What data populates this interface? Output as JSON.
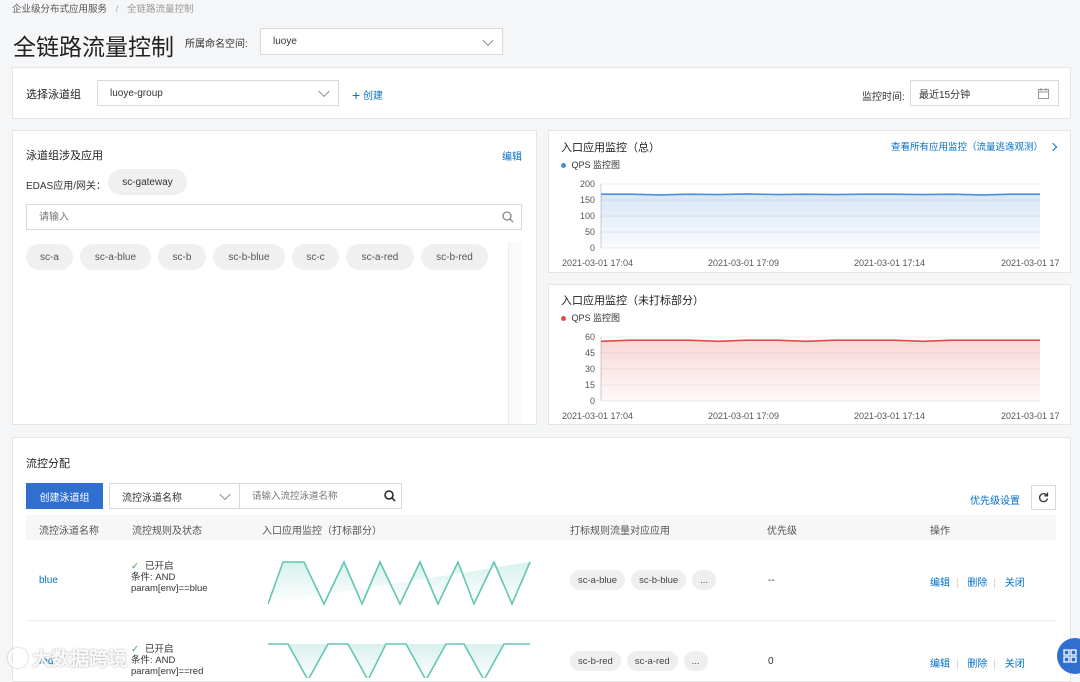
{
  "breadcrumb": {
    "parent": "企业级分布式应用服务",
    "separator": "/",
    "current": "全链路流量控制"
  },
  "page_title": "全链路流量控制",
  "namespace": {
    "label": "所属命名空间:",
    "value": "luoye"
  },
  "lane_group": {
    "label": "选择泳道组",
    "value": "luoye-group",
    "create": "创建",
    "monitor_label": "监控时间:",
    "monitor_value": "最近15分钟"
  },
  "apps_panel": {
    "title": "泳道组涉及应用",
    "edit": "编辑",
    "gateway_label": "EDAS应用/网关：",
    "gateway_tag": "sc-gateway",
    "search_placeholder": "请输入",
    "apps": [
      "sc-a",
      "sc-a-blue",
      "sc-b",
      "sc-b-blue",
      "sc-c",
      "sc-a-red",
      "sc-b-red"
    ]
  },
  "chart_top": {
    "title": "入口应用监控（总）",
    "link": "查看所有应用监控（流量逃逸观测）",
    "legend": "QPS 监控图"
  },
  "chart_bottom": {
    "title": "入口应用监控（未打标部分）",
    "legend": "QPS 监控图"
  },
  "chart_data": [
    {
      "type": "area",
      "series": [
        {
          "name": "QPS 监控图",
          "color": "#4a90d9"
        }
      ],
      "x": [
        "2021-03-01 17:04",
        "2021-03-01 17:05",
        "2021-03-01 17:06",
        "2021-03-01 17:07",
        "2021-03-01 17:08",
        "2021-03-01 17:09",
        "2021-03-01 17:10",
        "2021-03-01 17:11",
        "2021-03-01 17:12",
        "2021-03-01 17:13",
        "2021-03-01 17:14",
        "2021-03-01 17:15",
        "2021-03-01 17:16",
        "2021-03-01 17:17",
        "2021-03-01 17:18",
        "2021-03-01 17:19"
      ],
      "values": [
        168,
        168,
        166,
        168,
        167,
        169,
        167,
        168,
        167,
        168,
        168,
        167,
        168,
        166,
        168,
        168
      ],
      "xticks": [
        "2021-03-01 17:04",
        "2021-03-01 17:09",
        "2021-03-01 17:14",
        "2021-03-01 17"
      ],
      "yticks": [
        "200",
        "150",
        "100",
        "50",
        "0"
      ],
      "ylim": [
        0,
        200
      ]
    },
    {
      "type": "area",
      "series": [
        {
          "name": "QPS 监控图",
          "color": "#e24b4b"
        }
      ],
      "x": [
        "2021-03-01 17:04",
        "2021-03-01 17:05",
        "2021-03-01 17:06",
        "2021-03-01 17:07",
        "2021-03-01 17:08",
        "2021-03-01 17:09",
        "2021-03-01 17:10",
        "2021-03-01 17:11",
        "2021-03-01 17:12",
        "2021-03-01 17:13",
        "2021-03-01 17:14",
        "2021-03-01 17:15",
        "2021-03-01 17:16",
        "2021-03-01 17:17",
        "2021-03-01 17:18",
        "2021-03-01 17:19"
      ],
      "values": [
        56,
        57,
        57,
        57,
        56,
        57,
        57,
        56,
        57,
        57,
        57,
        56,
        57,
        57,
        57,
        57
      ],
      "xticks": [
        "2021-03-01 17:04",
        "2021-03-01 17:09",
        "2021-03-01 17:14",
        "2021-03-01 17"
      ],
      "yticks": [
        "60",
        "45",
        "30",
        "15",
        "0"
      ],
      "ylim": [
        0,
        60
      ]
    }
  ],
  "flow": {
    "title": "流控分配",
    "create_button": "创建泳道组",
    "filter_select": "流控泳道名称",
    "filter_placeholder": "请输入流控泳道名称",
    "priority_settings": "优先级设置",
    "columns": [
      "流控泳道名称",
      "流控规则及状态",
      "入口应用监控（打标部分）",
      "打标规则流量对应应用",
      "优先级",
      "操作"
    ],
    "rows": [
      {
        "name": "blue",
        "status": "已开启",
        "cond": "条件: AND",
        "param": "param[env]==blue",
        "apps": [
          "sc-a-blue",
          "sc-b-blue",
          "..."
        ],
        "priority": "--",
        "ops": [
          "编辑",
          "删除",
          "关闭"
        ]
      },
      {
        "name": "red",
        "status": "已开启",
        "cond": "条件: AND",
        "param": "param[env]==red",
        "apps": [
          "sc-b-red",
          "sc-a-red",
          "..."
        ],
        "priority": "0",
        "ops": [
          "编辑",
          "删除",
          "关闭"
        ]
      }
    ]
  },
  "watermark": "大数据跨境",
  "colors": {
    "primary": "#0070cc",
    "button": "#2f6fd0",
    "green": "#2fa24e",
    "teal": "#63c6b3"
  }
}
